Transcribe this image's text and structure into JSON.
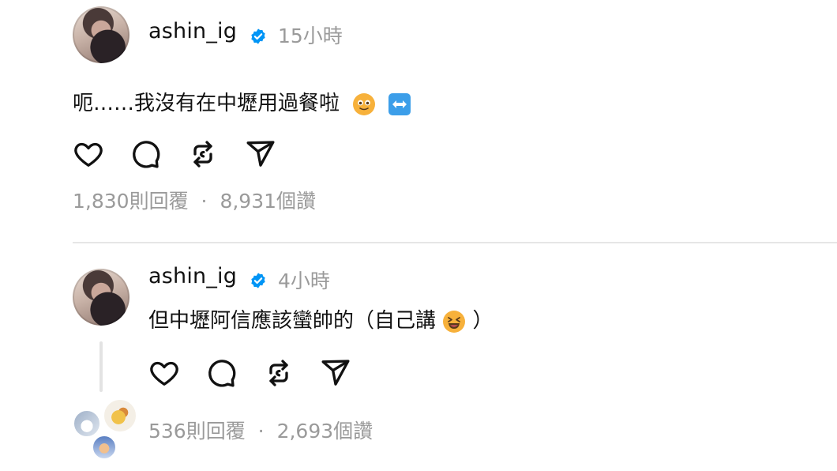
{
  "post": {
    "username": "ashin_ig",
    "time": "15小時",
    "text": "呃……我沒有在中壢用過餐啦",
    "emojis": [
      "smiling-face-emoji",
      "left-right-arrow-emoji"
    ],
    "replies": "1,830則回覆",
    "separator": "·",
    "likes": "8,931個讚"
  },
  "reply": {
    "username": "ashin_ig",
    "time": "4小時",
    "text": "但中壢阿信應該蠻帥的（自己講",
    "text_close": "）",
    "replies": "536則回覆",
    "separator": "·",
    "likes": "2,693個讚"
  },
  "icons": [
    "heart-icon",
    "comment-icon",
    "repost-icon",
    "share-icon",
    "verified-badge-icon"
  ],
  "colors": {
    "verified": "#0095f6",
    "muted": "#9a9a9a",
    "text": "#111111",
    "emoji": "#f7b13b",
    "arrow_emoji": "#3c9ee9"
  }
}
